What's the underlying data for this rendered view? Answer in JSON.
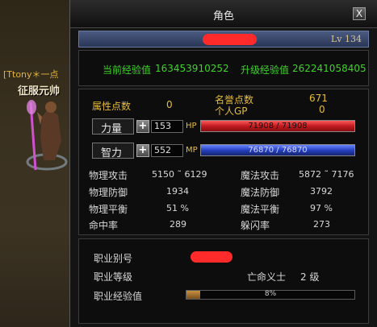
{
  "world": {
    "player_name": "[Ttony＊一点",
    "player_title": "征服元帅"
  },
  "window": {
    "title": "角色",
    "close_label": "X"
  },
  "header": {
    "level": "Lv 134"
  },
  "experience": {
    "current_label": "当前经验值",
    "current_value": "163453910252",
    "next_label": "升级经验值",
    "next_value": "262241058405"
  },
  "points": {
    "attr_points_label": "属性点数",
    "attr_points_value": "0",
    "honor_label": "名誉点数",
    "honor_value": "671",
    "gp_label": "个人GP",
    "gp_value": "0"
  },
  "strength": {
    "label": "力量",
    "value": "153",
    "bar_label": "HP",
    "bar_text": "71908 / 71908",
    "bar_fraction": 1.0
  },
  "intelligence": {
    "label": "智力",
    "value": "552",
    "bar_label": "MP",
    "bar_text": "76870 / 76870",
    "bar_fraction": 1.0
  },
  "stats": {
    "phys_atk_label": "物理攻击",
    "phys_atk_value": "5150 ˜ 6129",
    "mag_atk_label": "魔法攻击",
    "mag_atk_value": "5872 ˜ 7176",
    "phys_def_label": "物理防御",
    "phys_def_value": "1934",
    "mag_def_label": "魔法防御",
    "mag_def_value": "3792",
    "phys_bal_label": "物理平衡",
    "phys_bal_value": "51 %",
    "mag_bal_label": "魔法平衡",
    "mag_bal_value": "97 %",
    "hit_label": "命中率",
    "hit_value": "289",
    "dodge_label": "躲闪率",
    "dodge_value": "273"
  },
  "job": {
    "alias_label": "职业别号",
    "level_label": "职业等级",
    "class_name": "亡命义士",
    "class_level": "2 级",
    "exp_label": "职业经验值",
    "exp_percent": "8%",
    "exp_fraction": 0.08
  },
  "colors": {
    "hp_bar": "#d0242b",
    "mp_bar": "#2c4ac8",
    "accent_gold": "#e6bd3a",
    "exp_green": "#3ed42a",
    "redaction": "#ff2a2a"
  }
}
